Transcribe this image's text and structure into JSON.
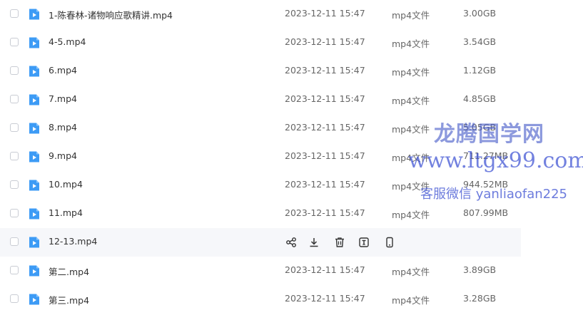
{
  "files": [
    {
      "name": "1-陈春林-诸物响应歌精讲.mp4",
      "date": "2023-12-11 15:47",
      "type": "mp4文件",
      "size": "3.00GB"
    },
    {
      "name": "4-5.mp4",
      "date": "2023-12-11 15:47",
      "type": "mp4文件",
      "size": "3.54GB"
    },
    {
      "name": "6.mp4",
      "date": "2023-12-11 15:47",
      "type": "mp4文件",
      "size": "1.12GB"
    },
    {
      "name": "7.mp4",
      "date": "2023-12-11 15:47",
      "type": "mp4文件",
      "size": "4.85GB"
    },
    {
      "name": "8.mp4",
      "date": "2023-12-11 15:47",
      "type": "mp4文件",
      "size": "5.05GB"
    },
    {
      "name": "9.mp4",
      "date": "2023-12-11 15:47",
      "type": "mp4文件",
      "size": "711.27MB"
    },
    {
      "name": "10.mp4",
      "date": "2023-12-11 15:47",
      "type": "mp4文件",
      "size": "944.52MB"
    },
    {
      "name": "11.mp4",
      "date": "2023-12-11 15:47",
      "type": "mp4文件",
      "size": "807.99MB"
    },
    {
      "name": "12-13.mp4",
      "hover": true
    },
    {
      "name": "第二.mp4",
      "date": "2023-12-11 15:47",
      "type": "mp4文件",
      "size": "3.89GB"
    },
    {
      "name": "第三.mp4",
      "date": "2023-12-11 15:47",
      "type": "mp4文件",
      "size": "3.28GB"
    }
  ],
  "row_actions": [
    "share-icon",
    "download-icon",
    "delete-icon",
    "text-icon",
    "mobile-icon"
  ],
  "watermark": {
    "line1": "龙腾国学网",
    "line2": "www.ltgx99.com",
    "line3": "客服微信 yanliaofan225"
  },
  "colors": {
    "file_icon": "#3d9bf5",
    "hover_row": "#f6f7fa"
  }
}
